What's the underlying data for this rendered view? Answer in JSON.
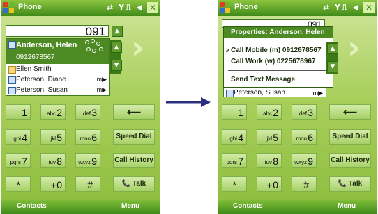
{
  "colors": {
    "accent": "#3f8a1a",
    "highlight": "#4e8a24",
    "arrow": "#2b2f80"
  },
  "title": "Phone",
  "status_icons": "⇄ Y⎍ ◀",
  "close_glyph": "✕",
  "left": {
    "number": "091",
    "contacts": [
      {
        "name": "Anderson, Helen",
        "type": "contact-icon",
        "selected": true
      },
      {
        "number": "0912678567",
        "selected": true
      },
      {
        "name": "Ellen Smith",
        "type": "card-icon"
      },
      {
        "name": "Peterson, Diane",
        "suffix": "m"
      },
      {
        "name": "Peterson, Susan",
        "suffix": "m"
      }
    ]
  },
  "right": {
    "number_partial": "091",
    "popup": {
      "header": "Properties: Anderson, Helen",
      "items": [
        {
          "label": "Call Mobile (m) 0912678567",
          "checked": true
        },
        {
          "label": "Call Work (w) 0225678967",
          "checked": false
        },
        {
          "label": "Send Text Message",
          "checked": false
        }
      ]
    },
    "behind_contact": "Peterson, Susan",
    "behind_suffix": "m"
  },
  "keypad": [
    {
      "big": "1",
      "sm": ""
    },
    {
      "big": "2",
      "sm": "abc"
    },
    {
      "big": "3",
      "sm": "def"
    },
    {
      "big": "4",
      "sm": "ghi"
    },
    {
      "big": "5",
      "sm": "jkl"
    },
    {
      "big": "6",
      "sm": "mno"
    },
    {
      "big": "7",
      "sm": "pqrs"
    },
    {
      "big": "8",
      "sm": "tuv"
    },
    {
      "big": "9",
      "sm": "wxyz"
    },
    {
      "big": "*",
      "sm": ""
    },
    {
      "big": "0",
      "sm": "+"
    },
    {
      "big": "#",
      "sm": ""
    }
  ],
  "side_keys": {
    "backspace": "⟵",
    "speed_dial": "Speed Dial",
    "call_history": "Call History",
    "talk": "Talk"
  },
  "menubar": {
    "left": "Contacts",
    "right": "Menu"
  }
}
